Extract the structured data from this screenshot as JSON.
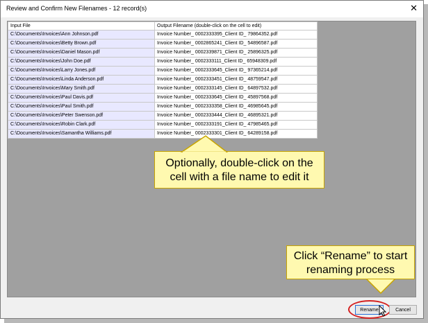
{
  "window": {
    "title": "Review and Confirm New Filenames - 12 record(s)",
    "close_symbol": "✕"
  },
  "table": {
    "headers": [
      "Input File",
      "Output Filename (double-click on the cell to edit)"
    ],
    "rows": [
      [
        "C:\\Documents\\Invoices\\Ann Johnson.pdf",
        "Invoice Number_ 0002333395_Client ID_ 79864352.pdf"
      ],
      [
        "C:\\Documents\\Invoices\\Betty Brown.pdf",
        "Invoice Number_ 0002865241_Client ID_ 54896587.pdf"
      ],
      [
        "C:\\Documents\\Invoices\\Daniel Mason.pdf",
        "Invoice Number_ 0002339871_Client ID_ 25896325.pdf"
      ],
      [
        "C:\\Documents\\Invoices\\John Doe.pdf",
        "Invoice Number_ 0002333111_Client ID_ 65948309.pdf"
      ],
      [
        "C:\\Documents\\Invoices\\Larry Jones.pdf",
        "Invoice Number_ 0002333645_Client ID_ 97365214.pdf"
      ],
      [
        "C:\\Documents\\Invoices\\Linda Anderson.pdf",
        "Invoice Number_ 0002333451_Client ID_ 48759547.pdf"
      ],
      [
        "C:\\Documents\\Invoices\\Mary Smith.pdf",
        "Invoice Number_ 0002333145_Client ID_ 64897532.pdf"
      ],
      [
        "C:\\Documents\\Invoices\\Paul Davis.pdf",
        "Invoice Number_ 0002333645_Client ID_ 45897568.pdf"
      ],
      [
        "C:\\Documents\\Invoices\\Paul Smith.pdf",
        "Invoice Number_ 0002333358_Client ID_ 46985645.pdf"
      ],
      [
        "C:\\Documents\\Invoices\\Peter Swenson.pdf",
        "Invoice Number_ 0002333444_Client ID_ 46895321.pdf"
      ],
      [
        "C:\\Documents\\Invoices\\Robin Clark.pdf",
        "Invoice Number_ 0002333191_Client ID_ 47985465.pdf"
      ],
      [
        "C:\\Documents\\Invoices\\Samantha Williams.pdf",
        "Invoice Number_ 0002333301_Client ID_ 64289158.pdf"
      ]
    ]
  },
  "buttons": {
    "rename": "Rename",
    "cancel": "Cancel"
  },
  "callouts": {
    "edit": [
      "Optionally, double-click on the",
      "cell with a file name to edit it"
    ],
    "rename": [
      "Click “Rename” to start",
      "renaming process"
    ]
  },
  "colors": {
    "input_cell_bg": "#e8e8ff",
    "callout_bg": "#fff9b0",
    "highlight_ring": "#d42020"
  }
}
